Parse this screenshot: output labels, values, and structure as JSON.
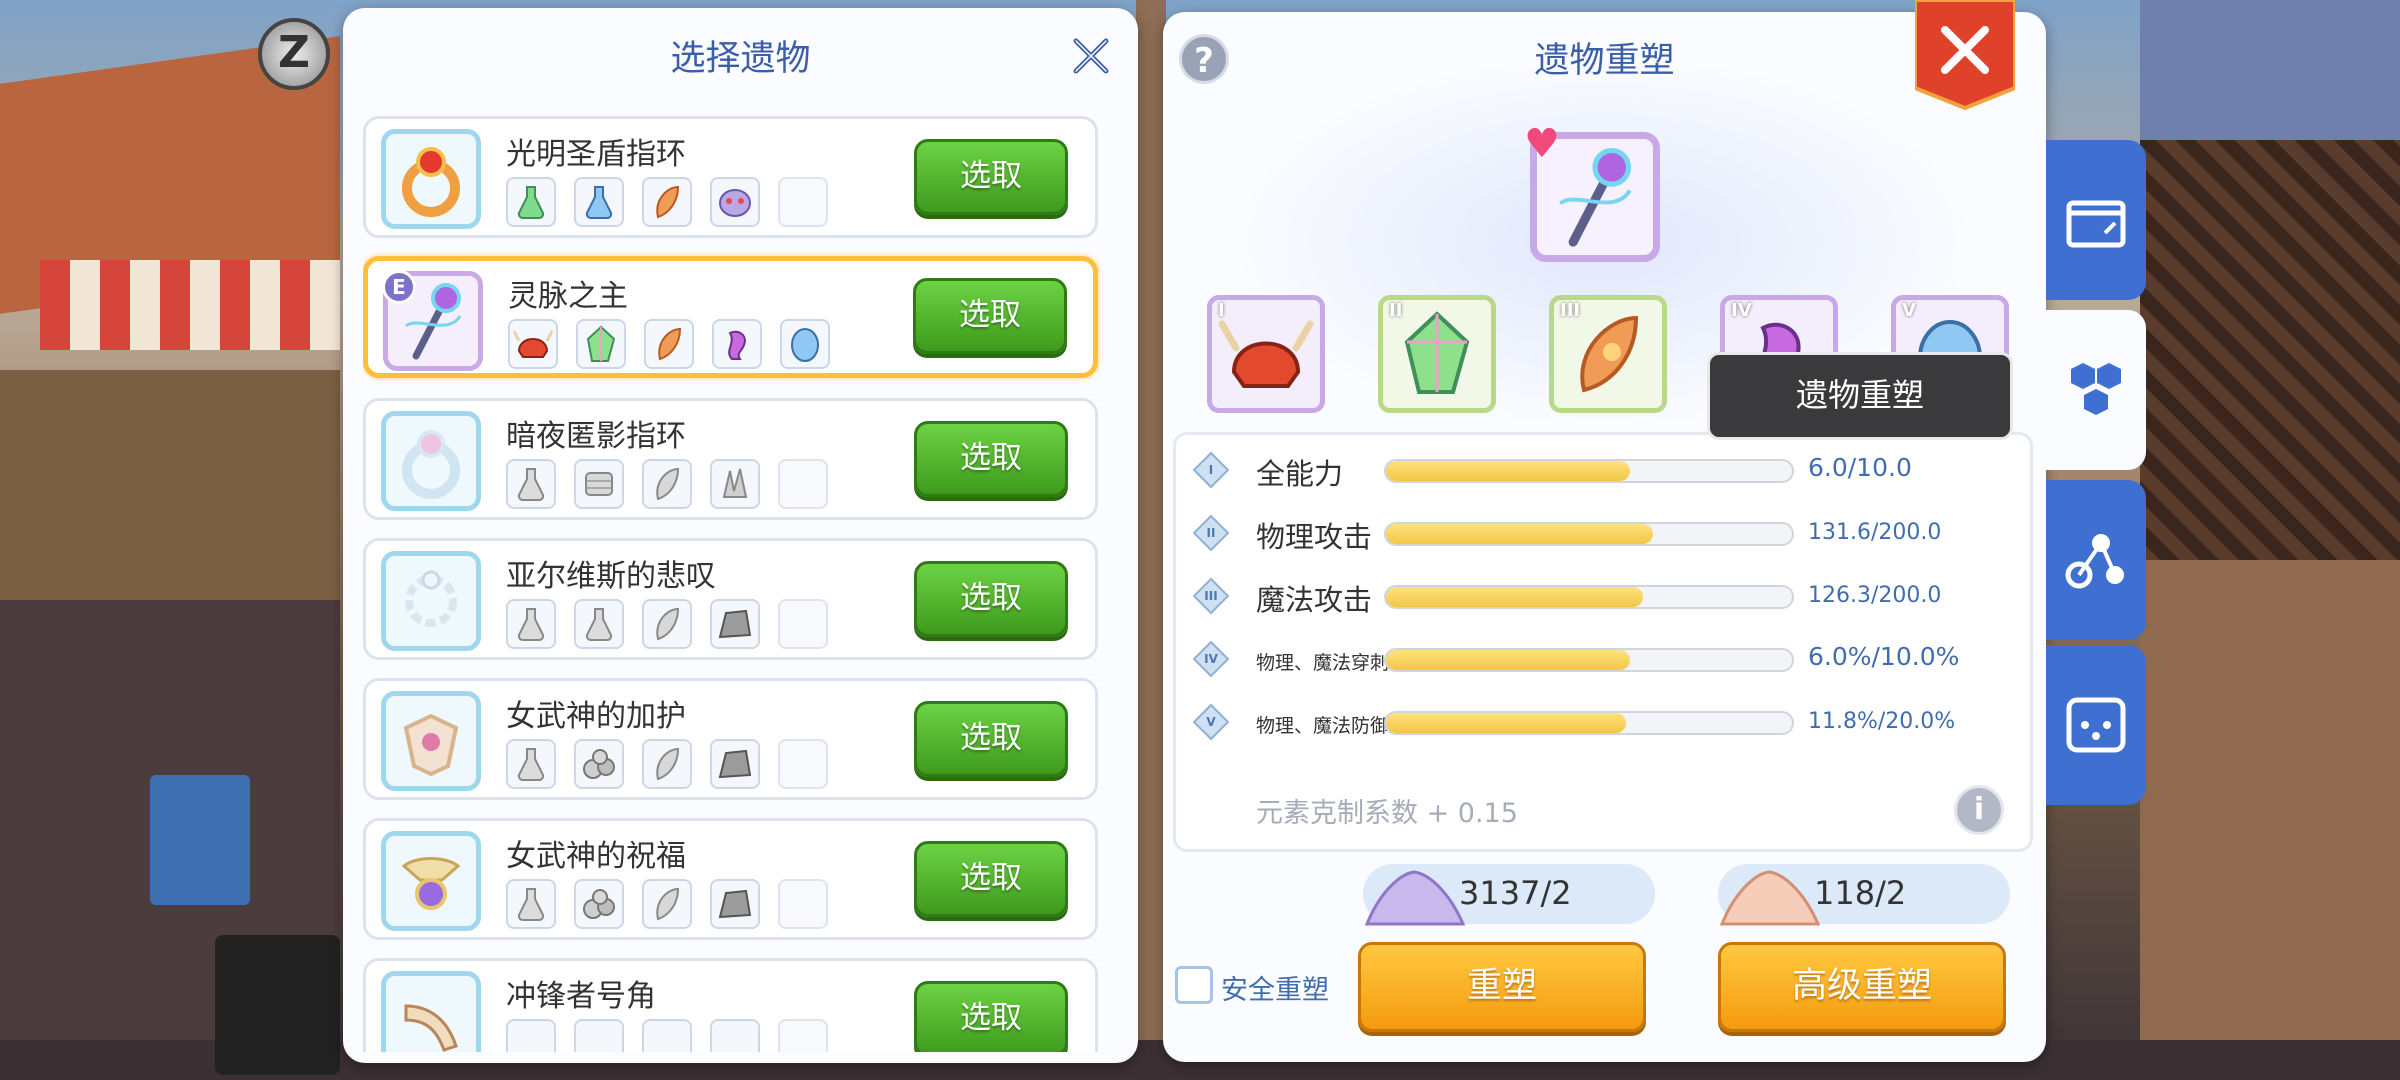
{
  "hud": {
    "z_label": "Z"
  },
  "left_panel": {
    "title": "选择遗物",
    "pick_label": "选取",
    "items": [
      {
        "name": "光明圣盾指环",
        "selected": false
      },
      {
        "name": "灵脉之主",
        "selected": true,
        "badge": "E"
      },
      {
        "name": "暗夜匿影指环",
        "selected": false
      },
      {
        "name": "亚尔维斯的悲叹",
        "selected": false
      },
      {
        "name": "女武神的加护",
        "selected": false
      },
      {
        "name": "女武神的祝福",
        "selected": false
      },
      {
        "name": "冲锋者号角",
        "selected": false
      }
    ]
  },
  "right_panel": {
    "title": "遗物重塑",
    "help": "?",
    "slot_numerals": [
      "I",
      "II",
      "III",
      "IV",
      "V"
    ],
    "tooltip": "遗物重塑",
    "stats": [
      {
        "numeral": "I",
        "label": "全能力",
        "value_text": "6.0/10.0",
        "fraction": 0.6
      },
      {
        "numeral": "II",
        "label": "物理攻击",
        "value_text": "131.6/200.0",
        "fraction": 0.658
      },
      {
        "numeral": "III",
        "label": "魔法攻击",
        "value_text": "126.3/200.0",
        "fraction": 0.632
      },
      {
        "numeral": "IV",
        "label": "物理、魔法穿刺",
        "value_text": "6.0%/10.0%",
        "fraction": 0.6
      },
      {
        "numeral": "V",
        "label": "物理、魔法防御",
        "value_text": "11.8%/20.0%",
        "fraction": 0.59
      }
    ],
    "element_text": "元素克制系数 + 0.15",
    "info": "i",
    "cost_purple": "3137/2",
    "cost_pink": "118/2",
    "safe_reforge_label": "安全重塑",
    "reforge_label": "重塑",
    "advanced_reforge_label": "高级重塑"
  },
  "colors": {
    "accent_blue": "#3b5ea8",
    "pick_green": "#4fb52a",
    "orange": "#f7a81c",
    "bar_yellow": "#f2c647"
  }
}
